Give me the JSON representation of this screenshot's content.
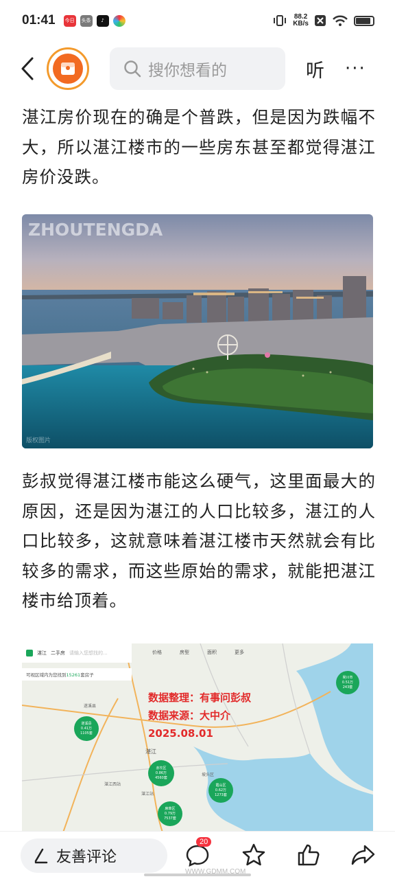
{
  "status_bar": {
    "time": "01:41",
    "app_icons": [
      {
        "name": "news-app-icon",
        "label": "今日",
        "color": "#e8353a"
      },
      {
        "name": "toutiao-app-icon",
        "label": "头条",
        "color": "#7a7a7a"
      },
      {
        "name": "tiktok-app-icon",
        "label": "",
        "color": "#111111"
      },
      {
        "name": "colorful-app-icon",
        "label": "",
        "color": "#3ab0f0"
      }
    ],
    "net_speed_value": "88.2",
    "net_speed_unit": "KB/s"
  },
  "nav": {
    "search_placeholder": "搜你想看的",
    "listen_label": "听",
    "more_label": "···"
  },
  "article": {
    "paragraph_1": "湛江房价现在的确是个普跌，但是因为跌幅不大，所以湛江楼市的一些房东甚至都觉得湛江房价没跌。",
    "photo": {
      "watermark": "ZHOUTENGDA",
      "credit": "版权图片"
    },
    "paragraph_2": "彭叔觉得湛江楼市能这么硬气，这里面最大的原因，还是因为湛江的人口比较多，湛江的人口比较多，这就意味着湛江楼市天然就会有比较多的需求，而这些原始的需求，就能把湛江楼市给顶着。",
    "map": {
      "app_city": "湛江",
      "tabs": [
        "二手房",
        "价格",
        "房型",
        "面积",
        "更多"
      ],
      "search_hint": "请输入您想找的...",
      "hint_line_prefix": "可视区域内为您找到",
      "hint_count": "15261",
      "hint_line_suffix": "套房子",
      "overlay_line_1": "数据整理：有事问彭叔",
      "overlay_line_2": "数据来源：大中介",
      "overlay_date": "2025.08.01",
      "clusters": [
        {
          "name": "遂溪县",
          "price": "0.41万",
          "count": "1105套"
        },
        {
          "name": "吴川市",
          "price": "0.51万",
          "count": "243套"
        },
        {
          "name": "赤坎区",
          "price": "0.86万",
          "count": "4560套"
        },
        {
          "name": "霞山区",
          "price": "0.62万",
          "count": "1273套"
        },
        {
          "name": "麻章区",
          "price": "0.79万",
          "count": "7537套"
        }
      ],
      "place_labels": [
        "遂溪县",
        "湛江",
        "坡头区",
        "湛江西站",
        "湛江站"
      ]
    }
  },
  "bottom_bar": {
    "comment_placeholder": "友善评论",
    "comment_count": "20",
    "site_watermark": "WWW.GDMM.COM"
  },
  "colors": {
    "accent_orange": "#f26a21",
    "badge_red": "#f5333f",
    "map_overlay_red": "#e22a2a",
    "cluster_green": "#1aa65a"
  }
}
